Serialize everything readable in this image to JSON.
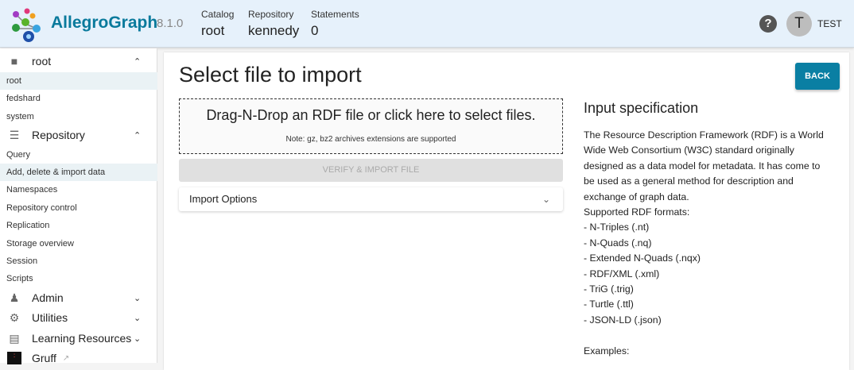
{
  "header": {
    "brand": "AllegroGraph",
    "version": "8.1.0",
    "catalog_label": "Catalog",
    "catalog": "root",
    "repository_label": "Repository",
    "repository": "kennedy",
    "statements_label": "Statements",
    "statements": "0",
    "help": "?",
    "avatar": "T",
    "user": "TEST"
  },
  "sidebar": {
    "catalogs": {
      "label": "root",
      "icon": "folder-icon",
      "items": [
        "root",
        "fedshard",
        "system"
      ]
    },
    "repository": {
      "label": "Repository",
      "icon": "storage-icon",
      "items": [
        "Query",
        "Add, delete & import data",
        "Namespaces",
        "Repository control",
        "Replication",
        "Storage overview",
        "Session",
        "Scripts"
      ]
    },
    "admin": "Admin",
    "utilities": "Utilities",
    "learning": "Learning Resources",
    "gruff": "Gruff"
  },
  "main": {
    "title": "Select file to import",
    "back": "BACK",
    "drop_message": "Drag-N-Drop an RDF file or click here to select files.",
    "drop_note": "Note: gz, bz2 archives extensions are supported",
    "verify": "VERIFY & IMPORT FILE",
    "import_options": "Import Options",
    "spec_title": "Input specification",
    "spec_lines": [
      "The Resource Description Framework (RDF) is a World",
      "Wide Web Consortium (W3C) standard originally",
      "designed as a data model for metadata. It has come to",
      "be used as a general method for description and",
      "exchange of graph data.",
      "Supported RDF formats:",
      "- N-Triples (.nt)",
      "- N-Quads (.nq)",
      "- Extended N-Quads (.nqx)",
      "- RDF/XML (.xml)",
      "- TriG (.trig)",
      "- Turtle (.ttl)",
      "- JSON-LD (.json)",
      "",
      "Examples:"
    ]
  },
  "colors": {
    "accent": "#0a7fa3",
    "header_bg": "#e6f1fb",
    "selected_bg": "#eaf2f5"
  }
}
